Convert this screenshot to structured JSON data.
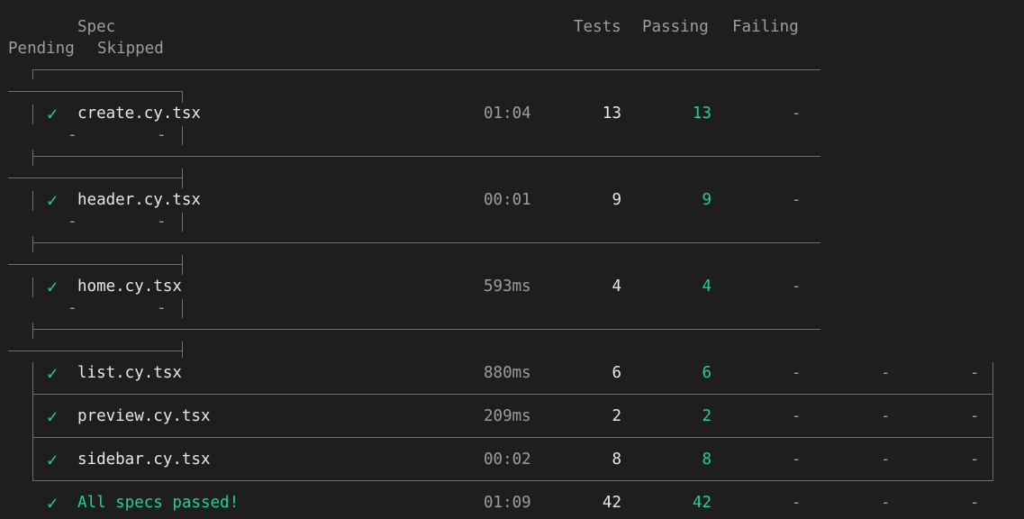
{
  "header": {
    "spec": "Spec",
    "tests": "Tests",
    "passing": "Passing",
    "failing": "Failing",
    "pending": "Pending",
    "skipped": "Skipped"
  },
  "check_glyph": "✓",
  "dash": "-",
  "rows": [
    {
      "spec": "create.cy.tsx",
      "duration": "01:04",
      "tests": "13",
      "passing": "13",
      "failing": "-",
      "pending": "-",
      "skipped": "-"
    },
    {
      "spec": "header.cy.tsx",
      "duration": "00:01",
      "tests": "9",
      "passing": "9",
      "failing": "-",
      "pending": "-",
      "skipped": "-"
    },
    {
      "spec": "home.cy.tsx",
      "duration": "593ms",
      "tests": "4",
      "passing": "4",
      "failing": "-",
      "pending": "-",
      "skipped": "-"
    },
    {
      "spec": "list.cy.tsx",
      "duration": "880ms",
      "tests": "6",
      "passing": "6",
      "failing": "-",
      "pending": "-",
      "skipped": "-"
    },
    {
      "spec": "preview.cy.tsx",
      "duration": "209ms",
      "tests": "2",
      "passing": "2",
      "failing": "-",
      "pending": "-",
      "skipped": "-"
    },
    {
      "spec": "sidebar.cy.tsx",
      "duration": "00:02",
      "tests": "8",
      "passing": "8",
      "failing": "-",
      "pending": "-",
      "skipped": "-"
    }
  ],
  "summary": {
    "label": "All specs passed!",
    "duration": "01:09",
    "tests": "42",
    "passing": "42",
    "failing": "-",
    "pending": "-",
    "skipped": "-"
  },
  "colors": {
    "background": "#1e1e1e",
    "success": "#23d18b",
    "border": "#6f6f6f"
  }
}
